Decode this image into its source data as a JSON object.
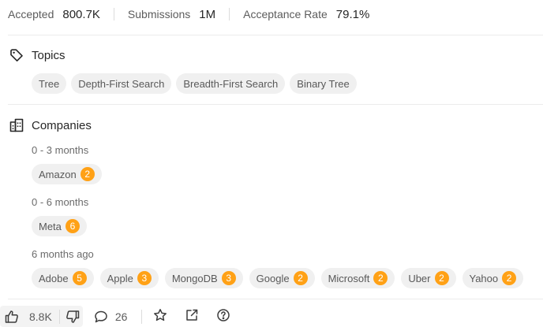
{
  "stats": {
    "accepted_label": "Accepted",
    "accepted_value": "800.7K",
    "submissions_label": "Submissions",
    "submissions_value": "1M",
    "acceptance_label": "Acceptance Rate",
    "acceptance_value": "79.1%"
  },
  "topics": {
    "title": "Topics",
    "tags": [
      "Tree",
      "Depth-First Search",
      "Breadth-First Search",
      "Binary Tree"
    ]
  },
  "companies": {
    "title": "Companies",
    "groups": [
      {
        "label": "0 - 3 months",
        "items": [
          {
            "name": "Amazon",
            "count": "2"
          }
        ]
      },
      {
        "label": "0 - 6 months",
        "items": [
          {
            "name": "Meta",
            "count": "6"
          }
        ]
      },
      {
        "label": "6 months ago",
        "items": [
          {
            "name": "Adobe",
            "count": "5"
          },
          {
            "name": "Apple",
            "count": "3"
          },
          {
            "name": "MongoDB",
            "count": "3"
          },
          {
            "name": "Google",
            "count": "2"
          },
          {
            "name": "Microsoft",
            "count": "2"
          },
          {
            "name": "Uber",
            "count": "2"
          },
          {
            "name": "Yahoo",
            "count": "2"
          }
        ]
      }
    ]
  },
  "footer": {
    "likes": "8.8K",
    "comments": "26"
  },
  "colors": {
    "accent": "#ffa116",
    "chip_bg": "#f0f0f0"
  },
  "icons": [
    "tag-icon",
    "building-icon",
    "thumbs-up-icon",
    "thumbs-down-icon",
    "comment-icon",
    "star-icon",
    "share-icon",
    "help-icon"
  ]
}
